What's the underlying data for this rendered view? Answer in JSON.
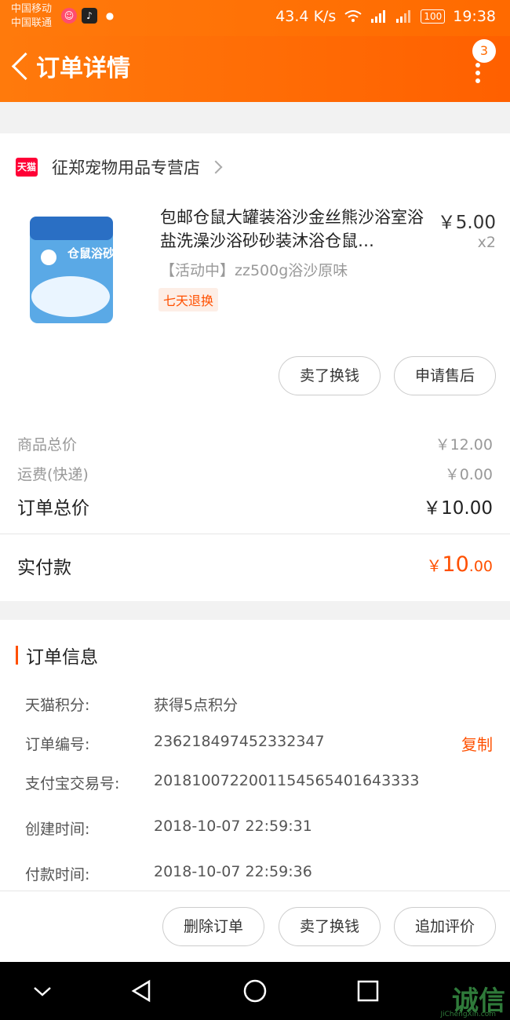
{
  "status_bar": {
    "carrier1": "中国移动",
    "carrier2": "中国联通",
    "speed": "43.4 K/s",
    "network1": "2G",
    "network2": "4G",
    "battery": "100",
    "time": "19:38"
  },
  "header": {
    "title": "订单详情",
    "badge": "3"
  },
  "store": {
    "badge": "天猫",
    "name": "征郑宠物用品专营店"
  },
  "product": {
    "title": "包邮仓鼠大罐装浴沙金丝熊沙浴室浴盐洗澡沙浴砂砂装沐浴仓鼠…",
    "price": "￥5.00",
    "qty": "x2",
    "sku": "【活动中】zz500g浴沙原味",
    "tag": "七天退换",
    "package_text": "仓鼠浴砂"
  },
  "item_actions": {
    "sell": "卖了换钱",
    "after_sale": "申请售后"
  },
  "summary": {
    "goods_label": "商品总价",
    "goods_value": "￥12.00",
    "shipping_label": "运费(快递)",
    "shipping_value": "￥0.00",
    "total_label": "订单总价",
    "total_value": "￥10.00",
    "paid_label": "实付款",
    "paid_symbol": "￥",
    "paid_int": "10",
    "paid_dec": ".00"
  },
  "order_info": {
    "title": "订单信息",
    "copy_label": "复制",
    "rows": [
      {
        "label": "天猫积分:",
        "value": "获得5点积分"
      },
      {
        "label": "订单编号:",
        "value": "236218497452332347"
      },
      {
        "label": "支付宝交易号:",
        "value": "2018100722001154565401643333"
      },
      {
        "label": "创建时间:",
        "value": "2018-10-07 22:59:31"
      },
      {
        "label": "付款时间:",
        "value": "2018-10-07 22:59:36"
      }
    ]
  },
  "bottom_actions": {
    "delete": "删除订单",
    "sell": "卖了换钱",
    "review": "追加评价"
  },
  "watermark": {
    "text": "诚信",
    "sub": "JiChengXin.com"
  },
  "colors": {
    "accent": "#ff6a00",
    "price_red": "#ff5000",
    "tmall_red": "#ff0036"
  }
}
